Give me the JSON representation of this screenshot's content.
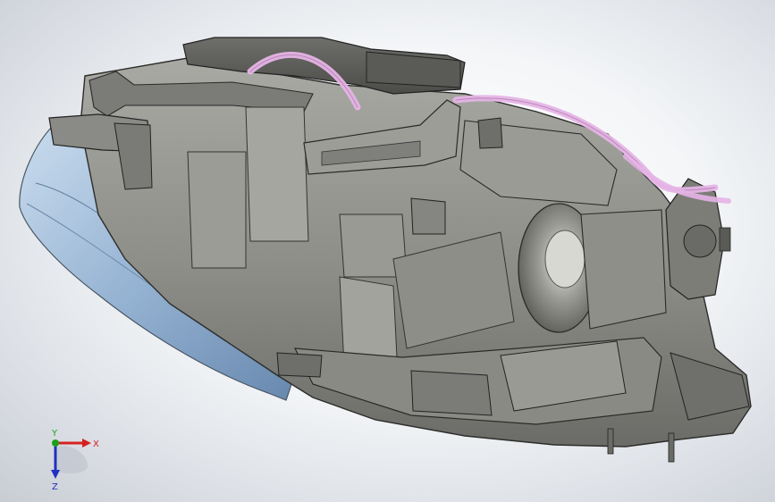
{
  "triad": {
    "x_label": "X",
    "y_label": "Y",
    "z_label": "Z",
    "x_color": "#d62020",
    "y_color": "#1aa01a",
    "z_color": "#2030c0"
  },
  "model": {
    "body_color": "#8f8f8a",
    "lens_color": "#8eaed0",
    "cable_color": "#e6b4e6"
  }
}
